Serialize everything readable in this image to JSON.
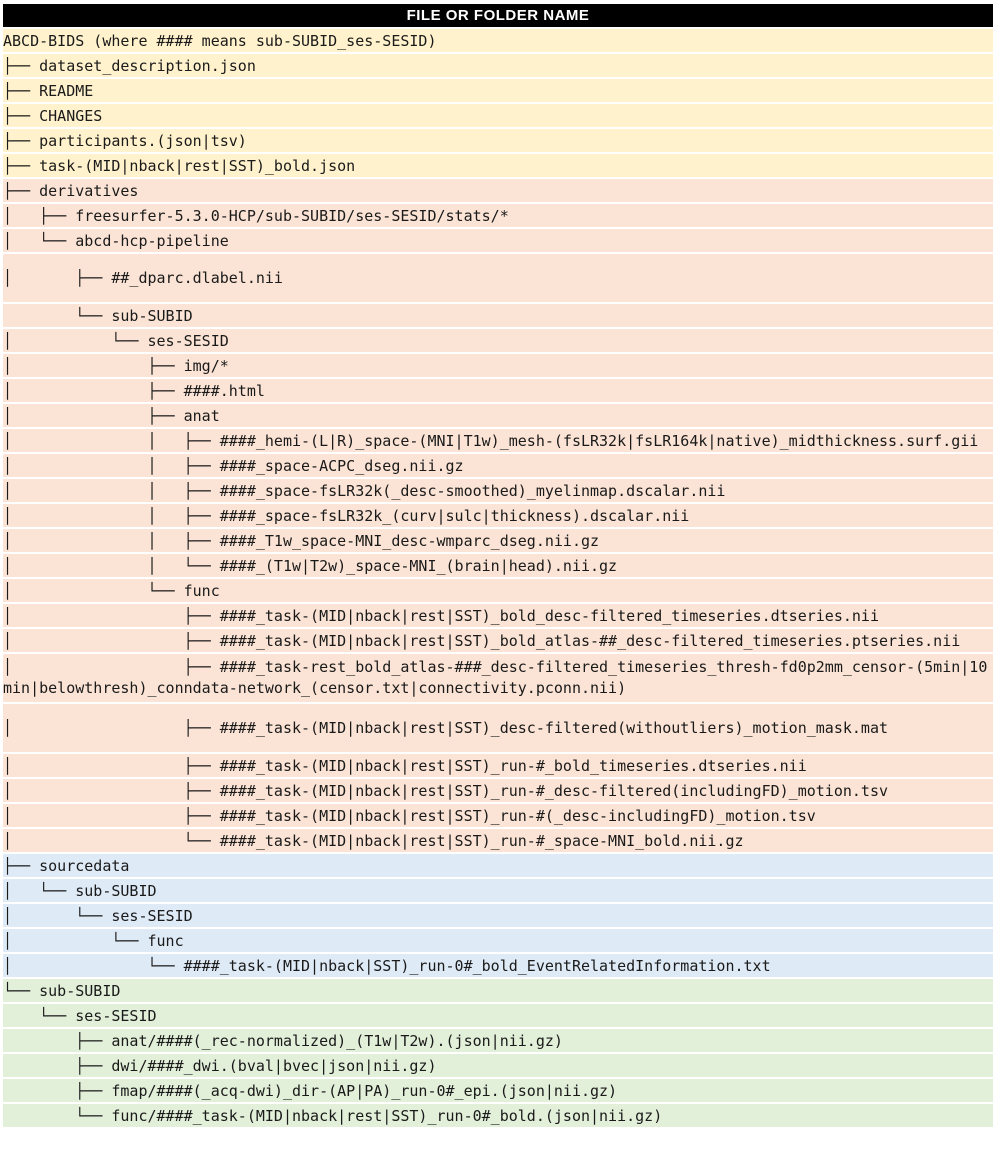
{
  "header": "FILE OR FOLDER NAME",
  "colors": {
    "yellow": "#fff2cc",
    "orange": "#fbe4d5",
    "blue": "#deeaf6",
    "green": "#e2efd9",
    "header_bg": "#000000"
  },
  "rows": [
    {
      "text": "ABCD-BIDS (where #### means sub-SUBID_ses-SESID)"
    },
    {
      "text": "├── dataset_description.json"
    },
    {
      "text": "├── README"
    },
    {
      "text": "├── CHANGES"
    },
    {
      "text": "├── participants.(json|tsv)"
    },
    {
      "text": "├── task-(MID|nback|rest|SST)_bold.json"
    },
    {
      "text": "├── derivatives"
    },
    {
      "text": "│   ├── freesurfer-5.3.0-HCP/sub-SUBID/ses-SESID/stats/*"
    },
    {
      "text": "│   └── abcd-hcp-pipeline"
    },
    {
      "text": "│       ├── ##_dparc.dlabel.nii"
    },
    {
      "text": "        └── sub-SUBID"
    },
    {
      "text": "│           └── ses-SESID"
    },
    {
      "text": "│               ├── img/*"
    },
    {
      "text": "│               ├── ####.html"
    },
    {
      "text": "│               ├── anat"
    },
    {
      "text": "│               │   ├── ####_hemi-(L|R)_space-(MNI|T1w)_mesh-(fsLR32k|fsLR164k|native)_midthickness.surf.gii"
    },
    {
      "text": "│               │   ├── ####_space-ACPC_dseg.nii.gz"
    },
    {
      "text": "│               │   ├── ####_space-fsLR32k(_desc-smoothed)_myelinmap.dscalar.nii"
    },
    {
      "text": "│               │   ├── ####_space-fsLR32k_(curv|sulc|thickness).dscalar.nii"
    },
    {
      "text": "│               │   ├── ####_T1w_space-MNI_desc-wmparc_dseg.nii.gz"
    },
    {
      "text": "│               │   └── ####_(T1w|T2w)_space-MNI_(brain|head).nii.gz"
    },
    {
      "text": "│               └── func"
    },
    {
      "text": "│                   ├── ####_task-(MID|nback|rest|SST)_bold_desc-filtered_timeseries.dtseries.nii"
    },
    {
      "text": "│                   ├── ####_task-(MID|nback|rest|SST)_bold_atlas-##_desc-filtered_timeseries.ptseries.nii"
    },
    {
      "text": "│                   ├── ####_task-rest_bold_atlas-###_desc-filtered_timeseries_thresh-fd0p2mm_censor-(5min|10min|belowthresh)_conndata-network_(censor.txt|connectivity.pconn.nii)"
    },
    {
      "text": "│                   ├── ####_task-(MID|nback|rest|SST)_desc-filtered(withoutliers)_motion_mask.mat"
    },
    {
      "text": "│                   ├── ####_task-(MID|nback|rest|SST)_run-#_bold_timeseries.dtseries.nii"
    },
    {
      "text": "│                   ├── ####_task-(MID|nback|rest|SST)_run-#_desc-filtered(includingFD)_motion.tsv"
    },
    {
      "text": "│                   ├── ####_task-(MID|nback|rest|SST)_run-#(_desc-includingFD)_motion.tsv"
    },
    {
      "text": "│                   └── ####_task-(MID|nback|rest|SST)_run-#_space-MNI_bold.nii.gz"
    },
    {
      "text": "├── sourcedata"
    },
    {
      "text": "│   └── sub-SUBID"
    },
    {
      "text": "│       └── ses-SESID"
    },
    {
      "text": "│           └── func"
    },
    {
      "text": "│               └── ####_task-(MID|nback|SST)_run-0#_bold_EventRelatedInformation.txt"
    },
    {
      "text": "└── sub-SUBID"
    },
    {
      "text": "    └── ses-SESID"
    },
    {
      "text": "        ├── anat/####(_rec-normalized)_(T1w|T2w).(json|nii.gz)"
    },
    {
      "text": "        ├── dwi/####_dwi.(bval|bvec|json|nii.gz)"
    },
    {
      "text": "        ├── fmap/####(_acq-dwi)_dir-(AP|PA)_run-0#_epi.(json|nii.gz)"
    },
    {
      "text": "        └── func/####_task-(MID|nback|rest|SST)_run-0#_bold.(json|nii.gz)"
    }
  ]
}
